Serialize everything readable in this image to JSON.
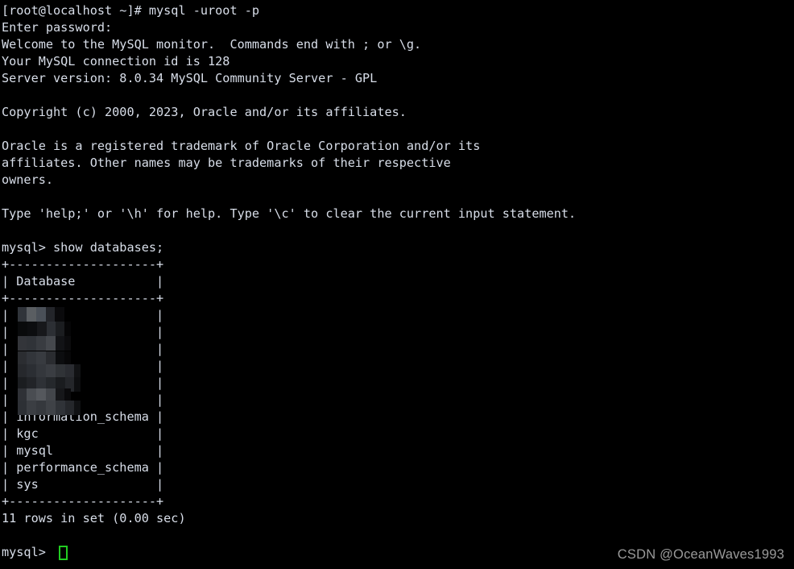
{
  "terminal": {
    "background_color": "#000000",
    "text_color": "#d8dee9",
    "cursor_color": "#22cc22",
    "lines": [
      "[root@localhost ~]# mysql -uroot -p",
      "Enter password:",
      "Welcome to the MySQL monitor.  Commands end with ; or \\g.",
      "Your MySQL connection id is 128",
      "Server version: 8.0.34 MySQL Community Server - GPL",
      "",
      "Copyright (c) 2000, 2023, Oracle and/or its affiliates.",
      "",
      "Oracle is a registered trademark of Oracle Corporation and/or its",
      "affiliates. Other names may be trademarks of their respective",
      "owners.",
      "",
      "Type 'help;' or '\\h' for help. Type '\\c' to clear the current input statement.",
      "",
      "mysql> show databases;",
      "+--------------------+",
      "| Database           |",
      "+--------------------+",
      "|                    |",
      "|                    |",
      "|                    |",
      "|                    |",
      "|                    |",
      "|                    |",
      "| information_schema |",
      "| kgc                |",
      "| mysql              |",
      "| performance_schema |",
      "| sys                |",
      "+--------------------+",
      "11 rows in set (0.00 sec)",
      "",
      "mysql> "
    ]
  },
  "prompt": {
    "host_prompt": "[root@localhost ~]#",
    "command": "mysql -uroot -p",
    "password_prompt": "Enter password:",
    "mysql_prompt": "mysql>",
    "query": "show databases;"
  },
  "server_info": {
    "welcome": "Welcome to the MySQL monitor.  Commands end with ; or \\g.",
    "connection_id_line": "Your MySQL connection id is 128",
    "connection_id": "128",
    "server_version_line": "Server version: 8.0.34 MySQL Community Server - GPL",
    "server_version": "8.0.34",
    "server_edition": "MySQL Community Server - GPL",
    "copyright": "Copyright (c) 2000, 2023, Oracle and/or its affiliates.",
    "trademark_line_1": "Oracle is a registered trademark of Oracle Corporation and/or its",
    "trademark_line_2": "affiliates. Other names may be trademarks of their respective",
    "trademark_line_3": "owners.",
    "help_line": "Type 'help;' or '\\h' for help. Type '\\c' to clear the current input statement."
  },
  "result_table": {
    "border": "+--------------------+",
    "header_row": "| Database           |",
    "header_label": "Database",
    "empty_row": "|                    |",
    "rows": [
      {
        "name": "",
        "redacted": true
      },
      {
        "name": "",
        "redacted": true
      },
      {
        "name": "",
        "redacted": true
      },
      {
        "name": "",
        "redacted": true
      },
      {
        "name": "",
        "redacted": true
      },
      {
        "name": "",
        "redacted": true
      },
      {
        "name": "information_schema",
        "redacted": false
      },
      {
        "name": "kgc",
        "redacted": false
      },
      {
        "name": "mysql",
        "redacted": false
      },
      {
        "name": "performance_schema",
        "redacted": false
      },
      {
        "name": "sys",
        "redacted": false
      }
    ],
    "row_count_label": "11 rows in set (0.00 sec)",
    "row_count": "11",
    "elapsed": "0.00 sec"
  },
  "watermark": {
    "text": "CSDN @OceanWaves1993"
  }
}
